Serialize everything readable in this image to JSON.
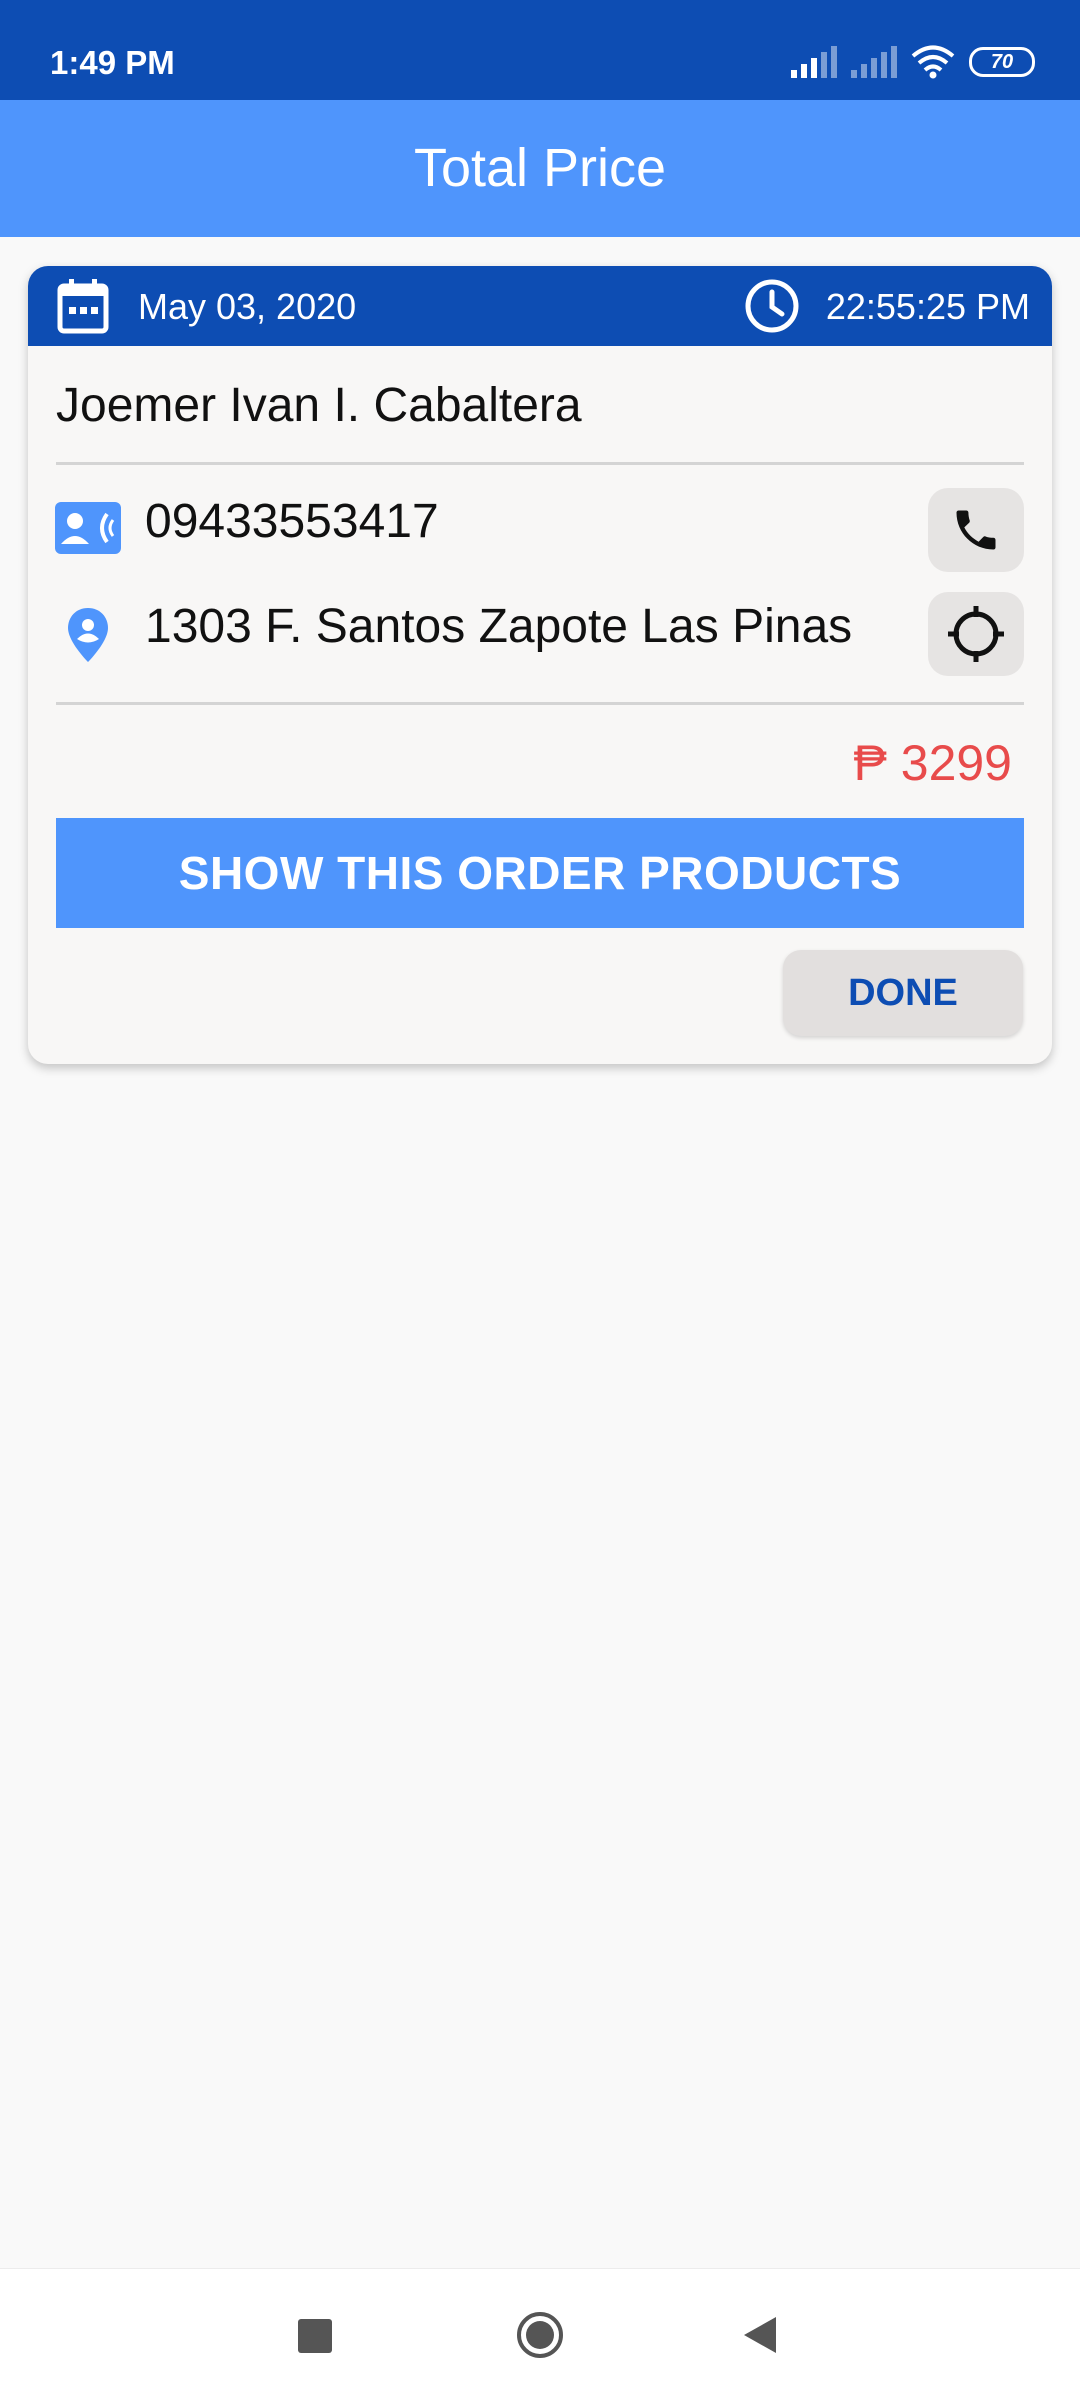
{
  "status_bar": {
    "time": "1:49 PM",
    "battery": "70",
    "icons": [
      "signal-icon",
      "signal-icon",
      "wifi-icon",
      "battery-icon"
    ]
  },
  "app_bar": {
    "title": "Total Price"
  },
  "order": {
    "date": "May 03, 2020",
    "time": "22:55:25 PM",
    "customer_name": "Joemer Ivan I. Cabaltera",
    "phone": "09433553417",
    "address": "1303 F. Santos Zapote Las Pinas",
    "price": "₱ 3299",
    "show_products_label": "SHOW THIS ORDER PRODUCTS",
    "done_label": "DONE"
  },
  "colors": {
    "primary_dark": "#0d4db3",
    "primary": "#4f95fc",
    "price": "#e84b4b",
    "background": "#f9f9f9"
  },
  "nav_bar": {
    "icons": [
      "recents-icon",
      "home-icon",
      "back-icon"
    ]
  }
}
